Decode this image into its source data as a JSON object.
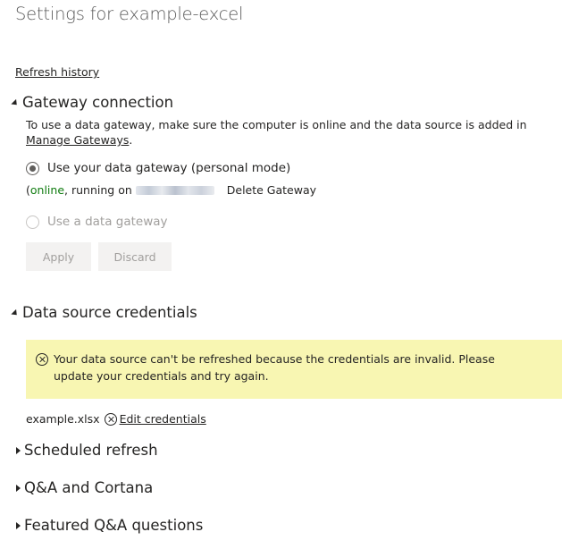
{
  "page": {
    "title": "Settings for example-excel"
  },
  "refresh_history": {
    "label": "Refresh history"
  },
  "gateway": {
    "heading": "Gateway connection",
    "description": "To use a data gateway, make sure the computer is online and the data source is added in ",
    "manage_link": "Manage Gateways",
    "description_end": ".",
    "option_personal": "Use your data gateway (personal mode)",
    "status_open": "(",
    "status_online": "online",
    "status_running": ", running on",
    "delete_label": "Delete Gateway",
    "option_gateway": "Use a data gateway",
    "apply_label": "Apply",
    "discard_label": "Discard"
  },
  "credentials": {
    "heading": "Data source credentials",
    "warning": "Your data source can't be refreshed because the credentials are invalid. Please update your credentials and try again.",
    "file_name": "example.xlsx",
    "edit_label": "Edit credentials"
  },
  "sections": {
    "scheduled": "Scheduled refresh",
    "qna": "Q&A and Cortana",
    "featured": "Featured Q&A questions"
  },
  "colors": {
    "online": "#107c10",
    "warning_bg": "#f8f6b2",
    "button_bg": "#f3f2f1"
  }
}
